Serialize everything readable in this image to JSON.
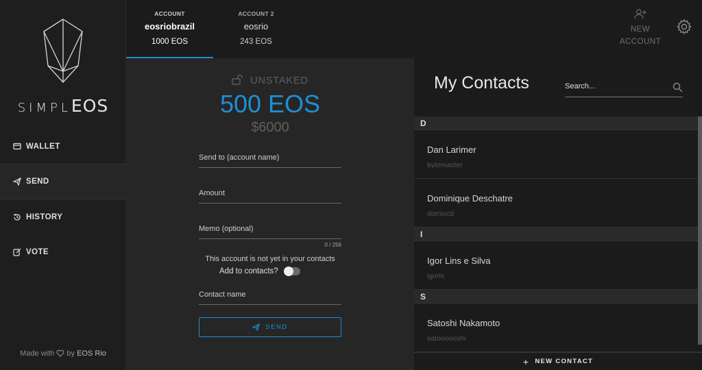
{
  "brand": {
    "logo_light": "SIMPL",
    "logo_bold": "EOS"
  },
  "sidebar": {
    "items": [
      {
        "label": "WALLET",
        "icon": "wallet-icon"
      },
      {
        "label": "SEND",
        "icon": "paper-plane-icon"
      },
      {
        "label": "HISTORY",
        "icon": "history-icon"
      },
      {
        "label": "VOTE",
        "icon": "edit-icon"
      }
    ],
    "active": "SEND",
    "footer": {
      "made_with": "Made with",
      "by": "by",
      "org": "EOS Rio"
    }
  },
  "accounts": [
    {
      "label": "ACCOUNT",
      "name": "eosriobrazil",
      "balance": "1000 EOS",
      "selected": true
    },
    {
      "label": "ACCOUNT 2",
      "name": "eosrio",
      "balance": "243 EOS",
      "selected": false
    }
  ],
  "header": {
    "new_account_line1": "NEW",
    "new_account_line2": "ACCOUNT"
  },
  "send": {
    "status": "UNSTAKED",
    "balance": "500 EOS",
    "usd": "$6000",
    "fields": {
      "to_placeholder": "Send to (account name)",
      "amount_placeholder": "Amount",
      "memo_placeholder": "Memo (optional)",
      "contact_placeholder": "Contact name"
    },
    "memo_counter": "0 / 256",
    "notice": "This account is not yet in your contacts",
    "add_to_contacts": "Add to contacts?",
    "add_to_contacts_on": false,
    "button": "SEND"
  },
  "contacts": {
    "title": "My Contacts",
    "search_placeholder": "Search...",
    "groups": [
      {
        "letter": "D",
        "items": [
          {
            "name": "Dan Larimer",
            "account": "bytemaster"
          },
          {
            "name": "Dominique Deschatre",
            "account": "domiscd"
          }
        ]
      },
      {
        "letter": "I",
        "items": [
          {
            "name": "Igor Lins e Silva",
            "account": "igorls"
          }
        ]
      },
      {
        "letter": "S",
        "items": [
          {
            "name": "Satoshi Nakamoto",
            "account": "satoooooshi"
          }
        ]
      }
    ],
    "new_contact": "NEW CONTACT"
  },
  "colors": {
    "accent": "#1e8fd6",
    "background": "#1b1b1b",
    "panel": "#262626"
  }
}
